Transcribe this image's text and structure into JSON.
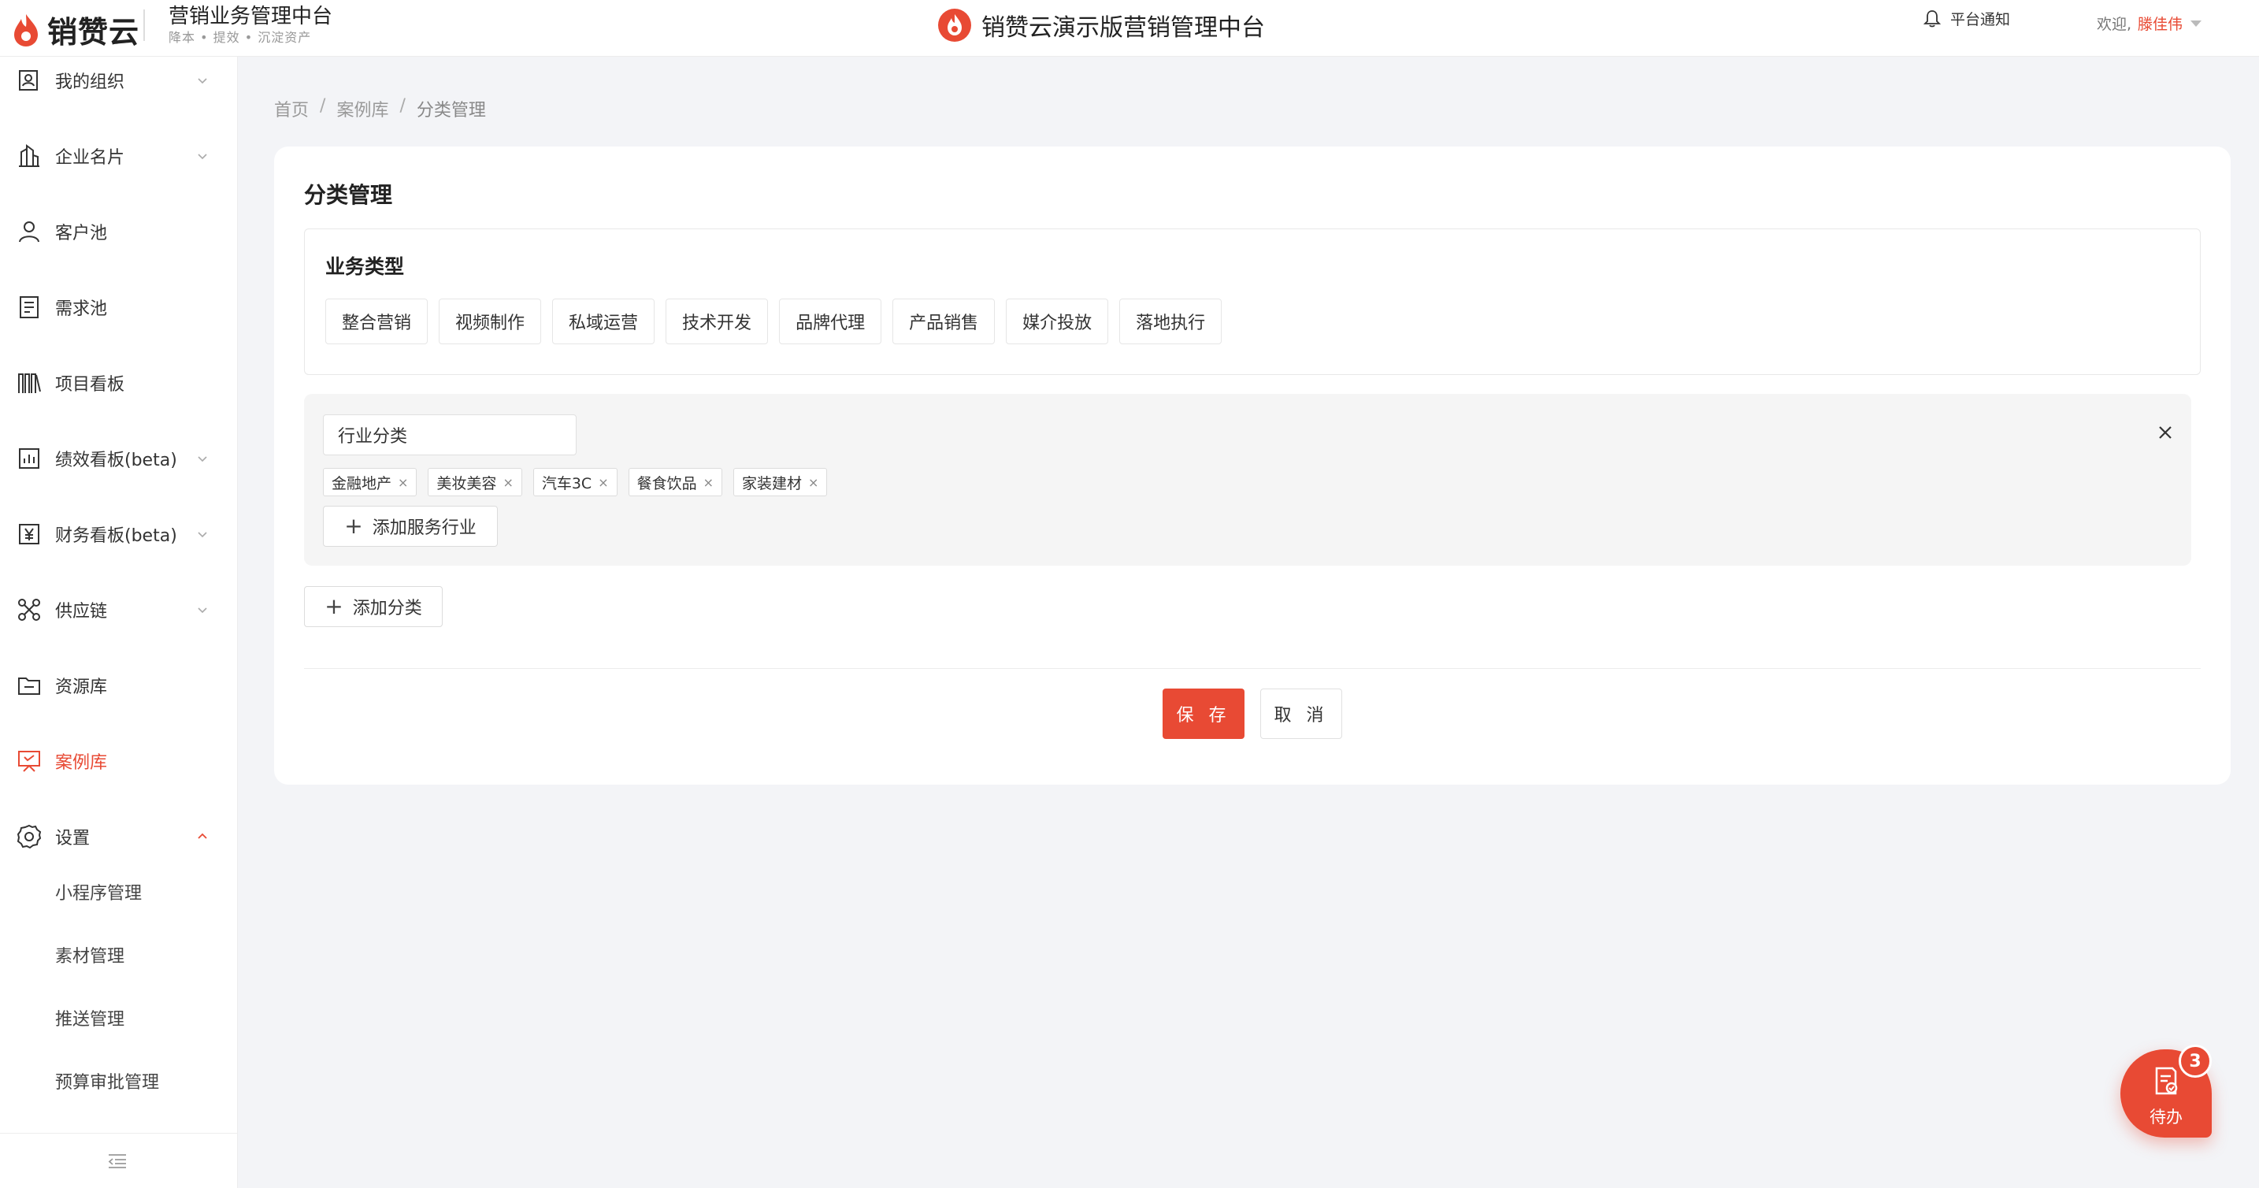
{
  "header": {
    "logo_text": "销赞云",
    "app_title": "营销业务管理中台",
    "app_subtitle": "降本 • 提效 • 沉淀资产",
    "center_title": "销赞云演示版营销管理中台",
    "notify_label": "平台通知",
    "welcome_label": "欢迎,",
    "user_name": "滕佳伟"
  },
  "sidebar": {
    "items": [
      {
        "label": "我的组织",
        "icon": "org-icon",
        "expandable": true
      },
      {
        "label": "企业名片",
        "icon": "building-icon",
        "expandable": true
      },
      {
        "label": "客户池",
        "icon": "user-icon",
        "expandable": false
      },
      {
        "label": "需求池",
        "icon": "document-icon",
        "expandable": false
      },
      {
        "label": "项目看板",
        "icon": "books-icon",
        "expandable": false
      },
      {
        "label": "绩效看板(beta)",
        "icon": "chart-icon",
        "expandable": true
      },
      {
        "label": "财务看板(beta)",
        "icon": "yen-icon",
        "expandable": true
      },
      {
        "label": "供应链",
        "icon": "network-icon",
        "expandable": true
      },
      {
        "label": "资源库",
        "icon": "folder-icon",
        "expandable": false
      },
      {
        "label": "案例库",
        "icon": "presentation-icon",
        "expandable": false,
        "active": true
      },
      {
        "label": "设置",
        "icon": "gear-icon",
        "expandable": true,
        "expanded": true
      }
    ],
    "sub_items": [
      "小程序管理",
      "素材管理",
      "推送管理",
      "预算审批管理"
    ]
  },
  "breadcrumb": [
    "首页",
    "案例库",
    "分类管理"
  ],
  "page": {
    "title": "分类管理",
    "business_section": {
      "title": "业务类型",
      "tags": [
        "整合营销",
        "视频制作",
        "私域运营",
        "技术开发",
        "品牌代理",
        "产品销售",
        "媒介投放",
        "落地执行"
      ]
    },
    "industry_section": {
      "input_value": "行业分类",
      "tags": [
        "金融地产",
        "美妆美容",
        "汽车3C",
        "餐食饮品",
        "家装建材"
      ],
      "add_label": "添加服务行业"
    },
    "add_category_label": "添加分类",
    "save_label": "保 存",
    "cancel_label": "取 消"
  },
  "todo": {
    "label": "待办",
    "count": "3"
  },
  "colors": {
    "accent": "#e84a34",
    "background": "#f3f4f7"
  }
}
